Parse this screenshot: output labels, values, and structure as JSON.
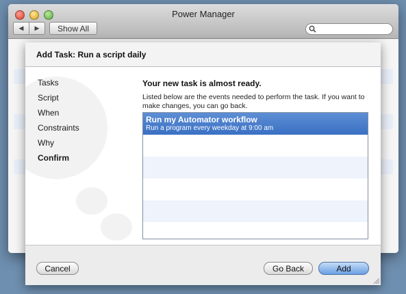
{
  "window": {
    "title": "Power Manager",
    "back_icon": "back-arrow-icon",
    "forward_icon": "forward-arrow-icon",
    "show_all_label": "Show All",
    "search_placeholder": "",
    "search_icon": "magnifier-icon"
  },
  "sheet": {
    "title": "Add Task: Run a script daily",
    "steps": [
      "Tasks",
      "Script",
      "When",
      "Constraints",
      "Why",
      "Confirm"
    ],
    "current_step": "Confirm",
    "heading": "Your new task is almost ready.",
    "description": "Listed below are the events needed to perform the task. If you want to make changes, you can go back.",
    "events": [
      {
        "title": "Run my Automator workflow",
        "subtitle": "Run a program every weekday at 9:00 am"
      }
    ],
    "buttons": {
      "cancel": "Cancel",
      "go_back": "Go Back",
      "add": "Add"
    }
  },
  "colors": {
    "selection": "#3a70c3",
    "accent_button": "#6aa0e3"
  }
}
